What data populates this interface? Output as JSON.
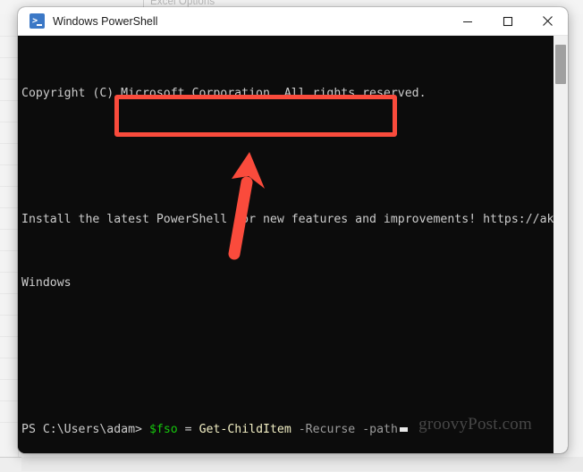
{
  "backdrop": {
    "excel_options_label": "Excel Options"
  },
  "window": {
    "title": "Windows PowerShell",
    "app_icon": "powershell-icon",
    "controls": {
      "minimize": "minimize-icon",
      "maximize": "maximize-icon",
      "close": "close-icon"
    }
  },
  "console": {
    "lines": [
      "Copyright (C) Microsoft Corporation. All rights reserved.",
      "",
      "Install the latest PowerShell for new features and improvements! https://aka.ms/PS",
      "Windows",
      ""
    ],
    "prompt": "PS C:\\Users\\adam>",
    "command": {
      "variable": "$fso",
      "equals": "=",
      "cmdlet": "Get-ChildItem",
      "param_recurse": "-Recurse",
      "param_path": "-path"
    },
    "colors": {
      "background": "#0c0c0c",
      "default_text": "#cccccc",
      "variable": "#16c60c",
      "cmdlet": "#f2efc4",
      "parameter": "#9b9b9b"
    }
  },
  "annotations": {
    "highlight_color": "#fa4b3c",
    "arrow_color": "#fa4b3c",
    "arrow_direction": "up"
  },
  "watermark": {
    "text": "groovyPost.com"
  }
}
